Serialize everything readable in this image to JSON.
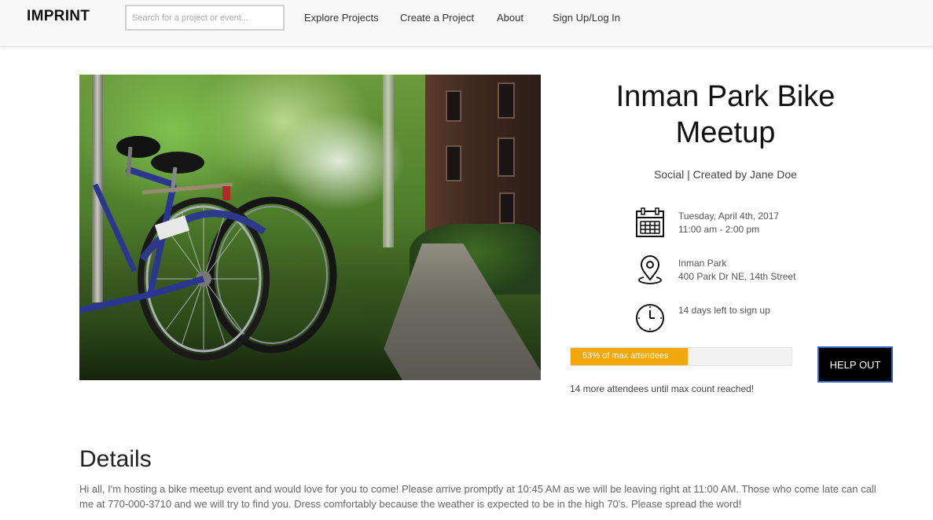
{
  "navbar": {
    "brand": "IMPRINT",
    "search_placeholder": "Search for a project or event...",
    "links": [
      "Explore Projects",
      "Create a Project",
      "About",
      "Sign Up/Log In"
    ]
  },
  "event": {
    "title": "Inman Park Bike Meetup",
    "subtitle": "Social | Created by Jane Doe",
    "date": "Tuesday, April 4th, 2017",
    "time": "11:00 am - 2:00 pm",
    "location_name": "Inman Park",
    "location_address": "400 Park Dr NE, 14th Street",
    "signup_remaining": "14 days left to sign up",
    "progress": {
      "fraction": 0.53,
      "label": "53% of max attendees",
      "color": "#f2a70a"
    },
    "attendee_note": "14 more attendees until max count reached!",
    "help_button": "HELP OUT"
  },
  "details": {
    "heading": "Details",
    "body": "Hi all, I'm hosting a bike meetup event and would love for you to come! Please arrive promptly at 10:45 AM as we will be leaving right at 11:00 AM. Those who come late can call me at 770-000-3710 and we will try to find you. Dress comfortably because the weather is expected to be in the high 70's. Please spread the word!"
  },
  "icons": {
    "date": "calendar-icon",
    "location": "map-pin-icon",
    "deadline": "clock-icon"
  }
}
